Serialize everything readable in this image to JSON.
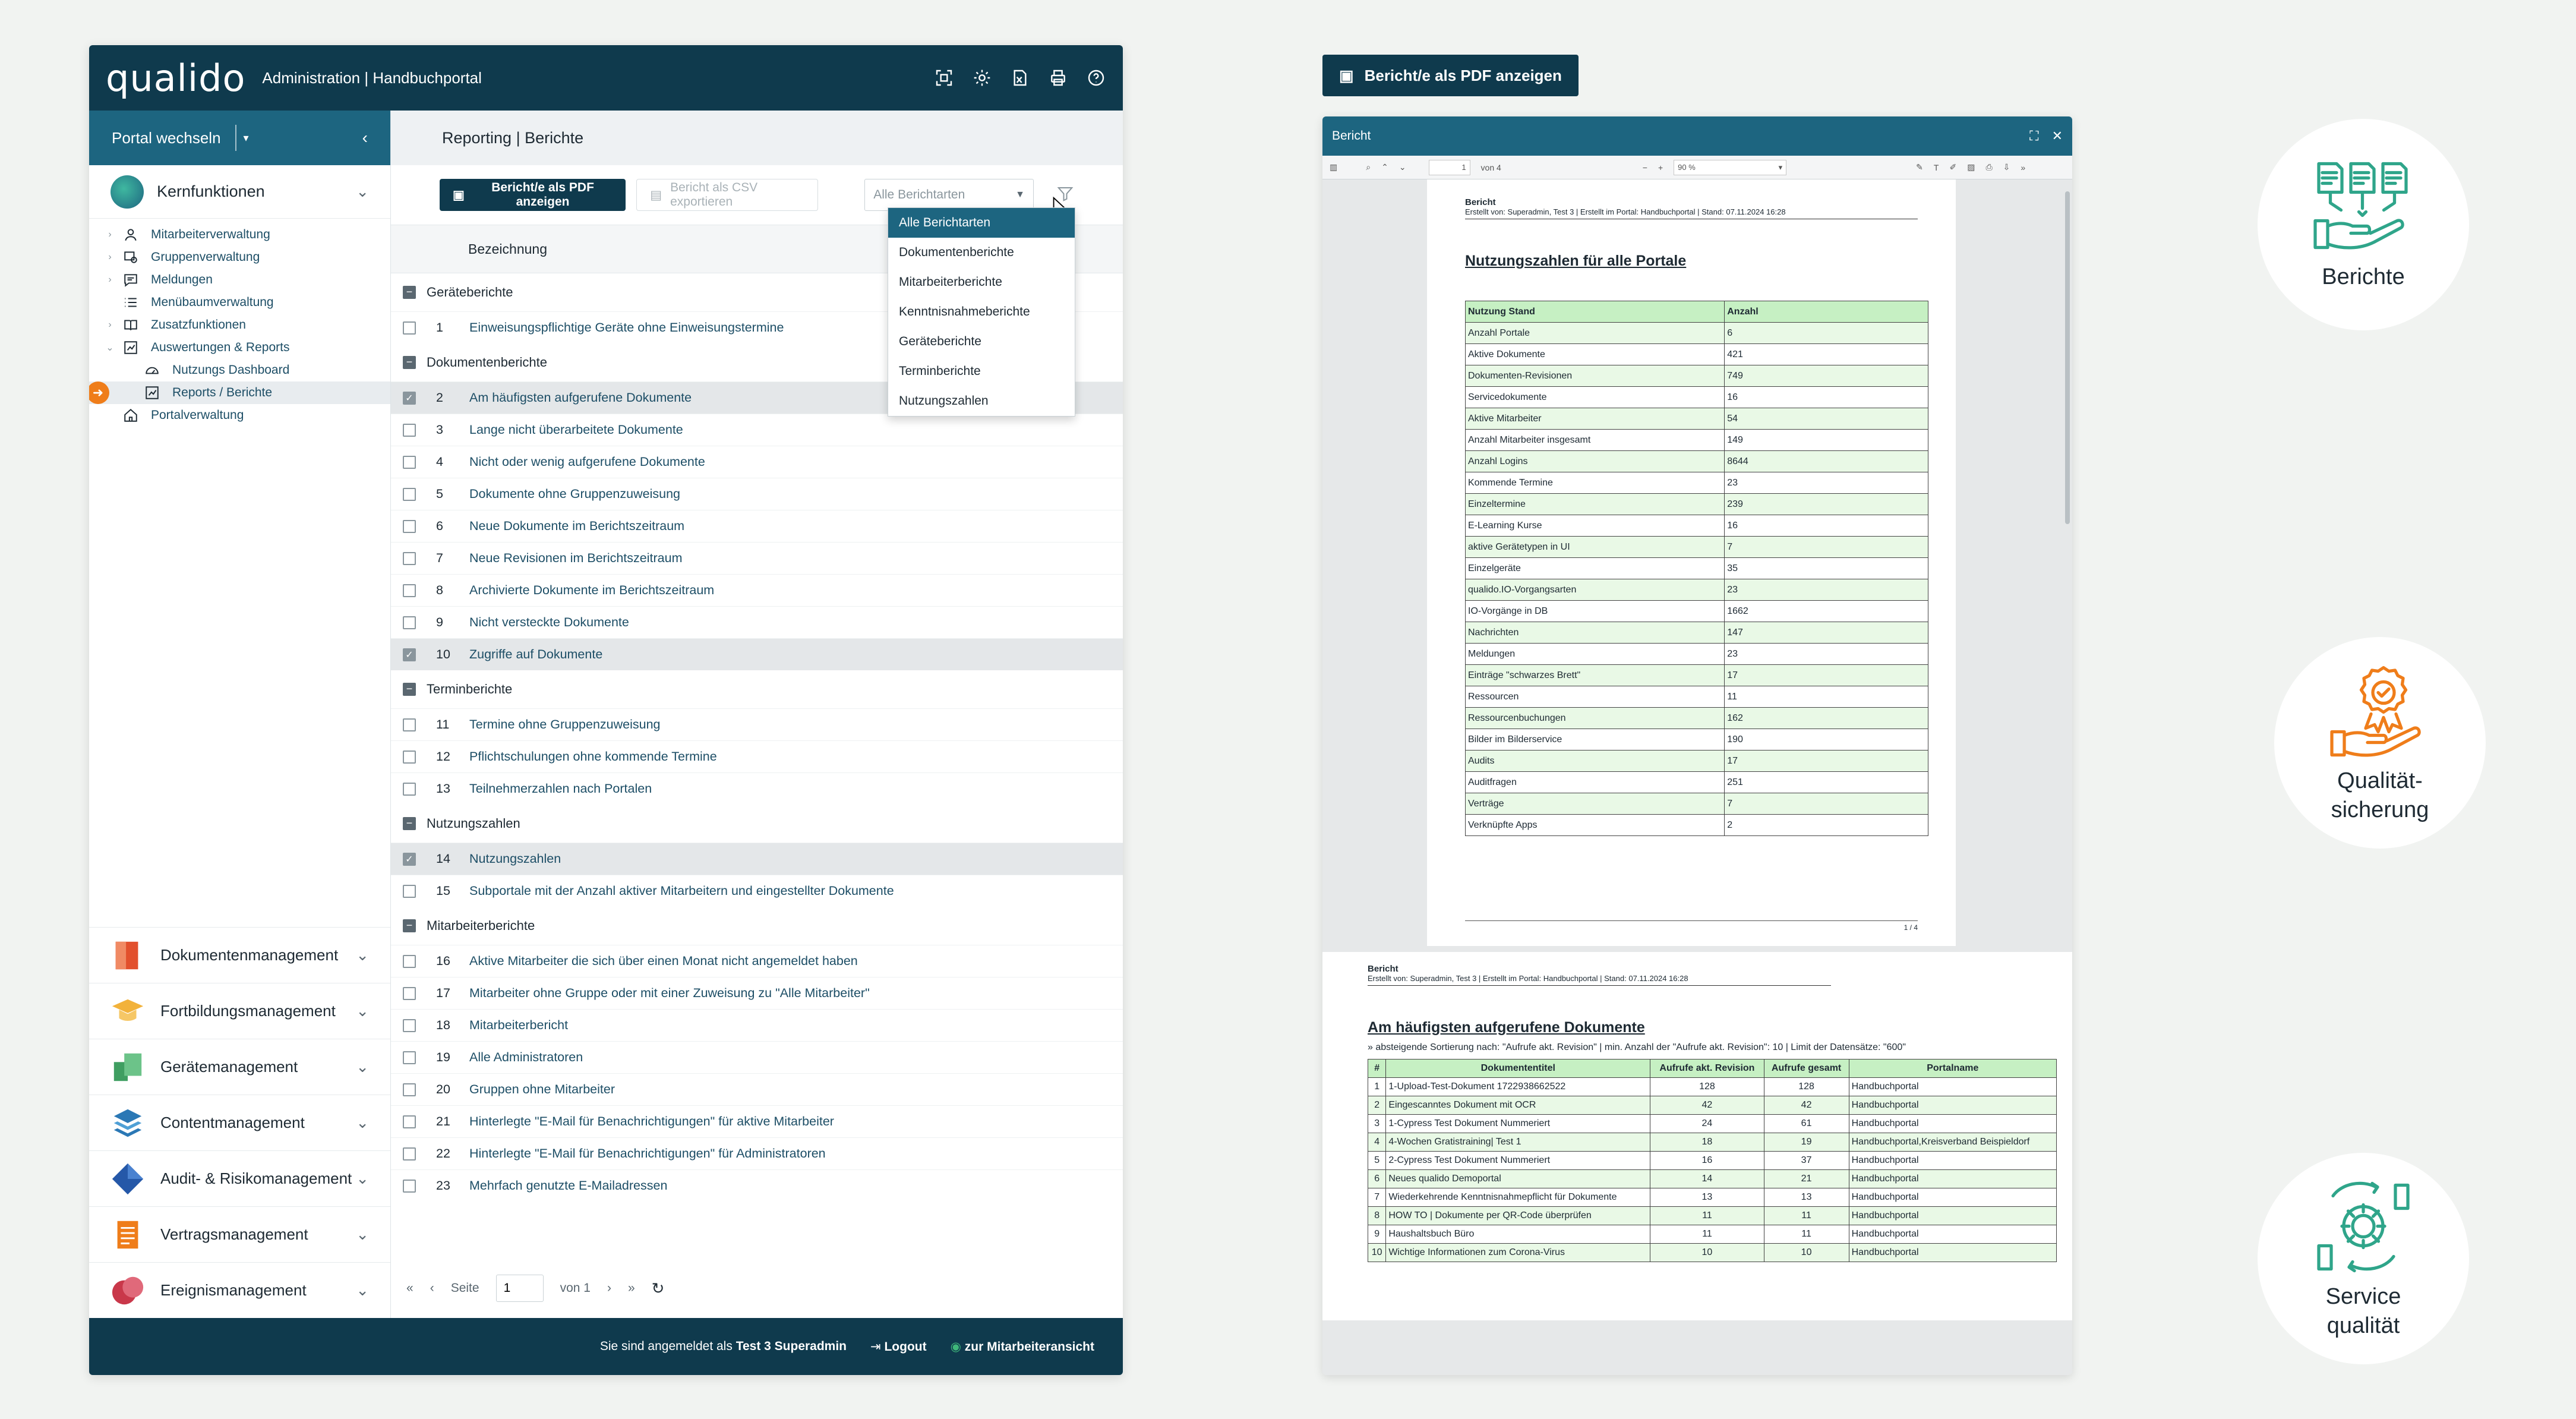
{
  "header": {
    "logo": "qualido",
    "subtitle": "Administration | Handbuchportal",
    "icons": [
      "qr-scan-icon",
      "gear-icon",
      "xlsx-icon",
      "print-icon",
      "help-icon"
    ]
  },
  "sidebar": {
    "portal_switch": "Portal wechseln",
    "kern": {
      "label": "Kernfunktionen",
      "items": [
        {
          "label": "Mitarbeiterverwaltung",
          "expand": "›"
        },
        {
          "label": "Gruppenverwaltung",
          "expand": "›"
        },
        {
          "label": "Meldungen",
          "expand": "›"
        },
        {
          "label": "Menübaumverwaltung",
          "expand": ""
        },
        {
          "label": "Zusatzfunktionen",
          "expand": "›"
        },
        {
          "label": "Auswertungen & Reports",
          "expand": "⌄"
        }
      ],
      "subitems": [
        {
          "label": "Nutzungs Dashboard"
        },
        {
          "label": "Reports / Berichte"
        }
      ],
      "last": "Portalverwaltung"
    },
    "modules": [
      {
        "label": "Dokumentenmanagement",
        "color": "#e2502d"
      },
      {
        "label": "Fortbildungsmanagement",
        "color": "#f2b23b"
      },
      {
        "label": "Gerätemanagement",
        "color": "#3f9e61"
      },
      {
        "label": "Contentmanagement",
        "color": "#2b78b5"
      },
      {
        "label": "Audit- & Risikomanagement",
        "color": "#2558a8"
      },
      {
        "label": "Vertragsmanagement",
        "color": "#ef7d1a"
      },
      {
        "label": "Ereignismanagement",
        "color": "#c9384a"
      }
    ]
  },
  "main": {
    "breadcrumb": "Reporting | Berichte",
    "btn_pdf": "Bericht/e als PDF anzeigen",
    "btn_csv": "Bericht als CSV exportieren",
    "select_placeholder": "Alle Berichtarten",
    "dropdown": [
      "Alle Berichtarten",
      "Dokumentenberichte",
      "Mitarbeiterberichte",
      "Kenntnisnahmeberichte",
      "Geräteberichte",
      "Terminberichte",
      "Nutzungszahlen"
    ],
    "col_header": "Bezeichnung",
    "groups": [
      {
        "title": "Geräteberichte",
        "rows": [
          {
            "n": "1",
            "label": "Einweisungspflichtige Geräte ohne Einweisungstermine",
            "checked": false
          }
        ]
      },
      {
        "title": "Dokumentenberichte",
        "rows": [
          {
            "n": "2",
            "label": "Am häufigsten aufgerufene Dokumente",
            "checked": true
          },
          {
            "n": "3",
            "label": "Lange nicht überarbeitete Dokumente",
            "checked": false
          },
          {
            "n": "4",
            "label": "Nicht oder wenig aufgerufene Dokumente",
            "checked": false
          },
          {
            "n": "5",
            "label": "Dokumente ohne Gruppenzuweisung",
            "checked": false
          },
          {
            "n": "6",
            "label": "Neue Dokumente im Berichtszeitraum",
            "checked": false
          },
          {
            "n": "7",
            "label": "Neue Revisionen im Berichtszeitraum",
            "checked": false
          },
          {
            "n": "8",
            "label": "Archivierte Dokumente im Berichtszeitraum",
            "checked": false
          },
          {
            "n": "9",
            "label": "Nicht versteckte Dokumente",
            "checked": false
          },
          {
            "n": "10",
            "label": "Zugriffe auf Dokumente",
            "checked": true
          }
        ]
      },
      {
        "title": "Terminberichte",
        "rows": [
          {
            "n": "11",
            "label": "Termine ohne Gruppenzuweisung",
            "checked": false
          },
          {
            "n": "12",
            "label": "Pflichtschulungen ohne kommende Termine",
            "checked": false
          },
          {
            "n": "13",
            "label": "Teilnehmerzahlen nach Portalen",
            "checked": false
          }
        ]
      },
      {
        "title": "Nutzungszahlen",
        "rows": [
          {
            "n": "14",
            "label": "Nutzungszahlen",
            "checked": true
          },
          {
            "n": "15",
            "label": "Subportale mit der Anzahl aktiver Mitarbeitern und eingestellter Dokumente",
            "checked": false
          }
        ]
      },
      {
        "title": "Mitarbeiterberichte",
        "rows": [
          {
            "n": "16",
            "label": "Aktive Mitarbeiter die sich über einen Monat nicht angemeldet haben",
            "checked": false
          },
          {
            "n": "17",
            "label": "Mitarbeiter ohne Gruppe oder mit einer Zuweisung zu \"Alle Mitarbeiter\"",
            "checked": false
          },
          {
            "n": "18",
            "label": "Mitarbeiterbericht",
            "checked": false
          },
          {
            "n": "19",
            "label": "Alle Administratoren",
            "checked": false
          },
          {
            "n": "20",
            "label": "Gruppen ohne Mitarbeiter",
            "checked": false
          },
          {
            "n": "21",
            "label": "Hinterlegte \"E-Mail für Benachrichtigungen\" für aktive Mitarbeiter",
            "checked": false
          },
          {
            "n": "22",
            "label": "Hinterlegte \"E-Mail für Benachrichtigungen\" für Administratoren",
            "checked": false
          },
          {
            "n": "23",
            "label": "Mehrfach genutzte E-Mailadressen",
            "checked": false
          }
        ]
      }
    ],
    "pager": {
      "seite": "Seite",
      "page": "1",
      "von": "von 1"
    }
  },
  "footer": {
    "logged_in": "Sie sind angemeldet als",
    "user": "Test 3 Superadmin",
    "logout": "Logout",
    "employee_view": "zur Mitarbeiteransicht"
  },
  "viewer": {
    "open_button": "Bericht/e als PDF anzeigen",
    "title": "Bericht",
    "page": "1",
    "of_pages": "von 4",
    "zoom": "90 %",
    "doc_title": "Bericht",
    "doc_meta": "Erstellt von: Superadmin, Test 3 | Erstellt im Portal: Handbuchportal | Stand: 07.11.2024 16:28",
    "usage_heading": "Nutzungszahlen für alle Portale",
    "usage_cols": [
      "Nutzung Stand",
      "Anzahl"
    ],
    "usage_rows": [
      [
        "Anzahl Portale",
        "6"
      ],
      [
        "Aktive Dokumente",
        "421"
      ],
      [
        "Dokumenten-Revisionen",
        "749"
      ],
      [
        "Servicedokumente",
        "16"
      ],
      [
        "Aktive Mitarbeiter",
        "54"
      ],
      [
        "Anzahl Mitarbeiter insgesamt",
        "149"
      ],
      [
        "Anzahl Logins",
        "8644"
      ],
      [
        "Kommende Termine",
        "23"
      ],
      [
        "Einzeltermine",
        "239"
      ],
      [
        "E-Learning Kurse",
        "16"
      ],
      [
        "aktive Gerätetypen in UI",
        "7"
      ],
      [
        "Einzelgeräte",
        "35"
      ],
      [
        "qualido.IO-Vorgangsarten",
        "23"
      ],
      [
        "IO-Vorgänge in DB",
        "1662"
      ],
      [
        "Nachrichten",
        "147"
      ],
      [
        "Meldungen",
        "23"
      ],
      [
        "Einträge \"schwarzes Brett\"",
        "17"
      ],
      [
        "Ressourcen",
        "11"
      ],
      [
        "Ressourcenbuchungen",
        "162"
      ],
      [
        "Bilder im Bilderservice",
        "190"
      ],
      [
        "Audits",
        "17"
      ],
      [
        "Auditfragen",
        "251"
      ],
      [
        "Verträge",
        "7"
      ],
      [
        "Verknüpfte Apps",
        "2"
      ]
    ],
    "page_footer": "1 / 4",
    "top_heading": "Am häufigsten aufgerufene Dokumente",
    "top_sub": "» absteigende Sortierung nach: \"Aufrufe akt. Revision\" | min. Anzahl der \"Aufrufe akt. Revision\": 10 | Limit der Datensätze: \"600\"",
    "top_cols": [
      "#",
      "Dokumententitel",
      "Aufrufe akt. Revision",
      "Aufrufe gesamt",
      "Portalname"
    ],
    "top_rows": [
      [
        "1",
        "1-Upload-Test-Dokument 1722938662522",
        "128",
        "128",
        "Handbuchportal"
      ],
      [
        "2",
        "Eingescanntes Dokument mit OCR",
        "42",
        "42",
        "Handbuchportal"
      ],
      [
        "3",
        "1-Cypress Test Dokument Nummeriert",
        "24",
        "61",
        "Handbuchportal"
      ],
      [
        "4",
        "4-Wochen Gratistraining| Test 1",
        "18",
        "19",
        "Handbuchportal,Kreisverband Beispieldorf"
      ],
      [
        "5",
        "2-Cypress Test Dokument Nummeriert",
        "16",
        "37",
        "Handbuchportal"
      ],
      [
        "6",
        "Neues qualido Demoportal",
        "14",
        "21",
        "Handbuchportal"
      ],
      [
        "7",
        "Wiederkehrende Kenntnisnahmepflicht für Dokumente",
        "13",
        "13",
        "Handbuchportal"
      ],
      [
        "8",
        "HOW TO | Dokumente per QR-Code überprüfen",
        "11",
        "11",
        "Handbuchportal"
      ],
      [
        "9",
        "Haushaltsbuch Büro",
        "11",
        "11",
        "Handbuchportal"
      ],
      [
        "10",
        "Wichtige Informationen zum Corona-Virus",
        "10",
        "10",
        "Handbuchportal"
      ]
    ]
  },
  "features": [
    {
      "label": "Berichte",
      "icon": "reports-hand-icon"
    },
    {
      "label": "Qualität-\nsicherung",
      "icon": "quality-badge-hand-icon"
    },
    {
      "label": "Service\nqualität",
      "icon": "service-gear-hands-icon"
    }
  ],
  "colors": {
    "navy": "#0f3a4d",
    "teal": "#1d6580",
    "accent": "#ef7d1a",
    "feature_green": "#2fa58a"
  }
}
